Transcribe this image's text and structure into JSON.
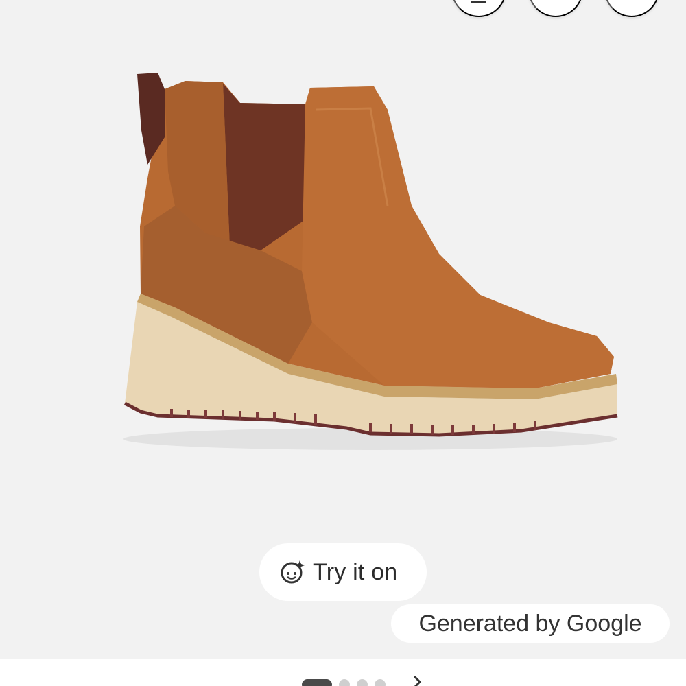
{
  "viewer": {
    "top_buttons": [
      "download-icon",
      "share-icon",
      "more-icon"
    ],
    "product_image": {
      "alt": "Brown leather Chelsea ankle boot with cream wedge sole"
    },
    "try_it_on": {
      "icon": "face-sparkle-icon",
      "label": "Try it on"
    },
    "generated_badge": "Generated by Google"
  },
  "carousel": {
    "active_index": 0,
    "count": 4
  },
  "colors": {
    "background": "#f2f2f2",
    "leather": "#b86a32",
    "elastic": "#6e3424",
    "sole": "#ecd9b8"
  }
}
